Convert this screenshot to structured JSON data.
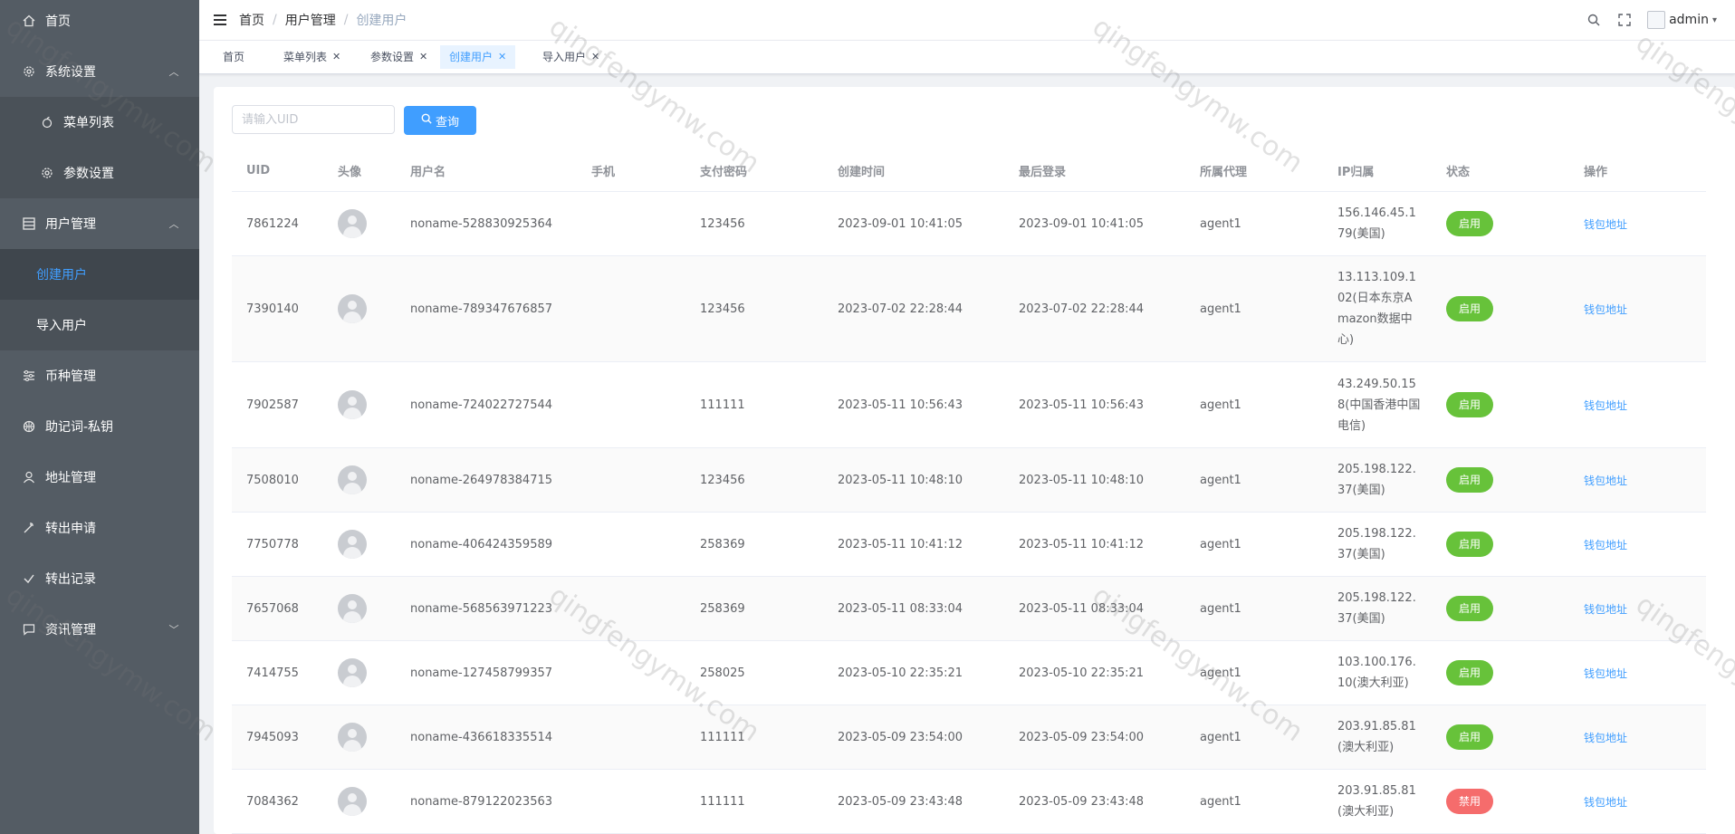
{
  "sidebar": {
    "items": [
      {
        "label": "首页",
        "icon": "home-icon"
      },
      {
        "label": "系统设置",
        "icon": "gear-icon"
      },
      {
        "label": "菜单列表",
        "icon": "apple-icon"
      },
      {
        "label": "参数设置",
        "icon": "gear-icon"
      },
      {
        "label": "用户管理",
        "icon": "grid-icon"
      },
      {
        "label": "创建用户"
      },
      {
        "label": "导入用户"
      },
      {
        "label": "币种管理",
        "icon": "sliders-icon"
      },
      {
        "label": "助记词-私钥",
        "icon": "basketball-icon"
      },
      {
        "label": "地址管理",
        "icon": "user-icon"
      },
      {
        "label": "转出申请",
        "icon": "magic-stick-icon"
      },
      {
        "label": "转出记录",
        "icon": "receipt-icon"
      },
      {
        "label": "资讯管理",
        "icon": "chat-icon"
      }
    ]
  },
  "header": {
    "breadcrumb": [
      "首页",
      "用户管理",
      "创建用户"
    ],
    "separator": "/",
    "user": "admin"
  },
  "tags": [
    {
      "label": "首页"
    },
    {
      "label": "菜单列表",
      "close": "✕"
    },
    {
      "label": "参数设置",
      "close": "✕"
    },
    {
      "label": "创建用户",
      "close": "✕"
    },
    {
      "label": "导入用户",
      "close": "✕"
    }
  ],
  "search": {
    "placeholder": "请输入UID",
    "button": "查询"
  },
  "table": {
    "columns": [
      "UID",
      "头像",
      "用户名",
      "手机",
      "支付密码",
      "创建时间",
      "最后登录",
      "所属代理",
      "IP归属",
      "状态",
      "操作"
    ],
    "rows": [
      {
        "uid": "7861224",
        "username": "noname-528830925364",
        "phone": "",
        "paypwd": "123456",
        "created": "2023-09-01 10:41:05",
        "lastlogin": "2023-09-01 10:41:05",
        "agent": "agent1",
        "ip": "156.146.45.179(美国)",
        "status": "启用",
        "action": "钱包地址"
      },
      {
        "uid": "7390140",
        "username": "noname-789347676857",
        "phone": "",
        "paypwd": "123456",
        "created": "2023-07-02 22:28:44",
        "lastlogin": "2023-07-02 22:28:44",
        "agent": "agent1",
        "ip": "13.113.109.102(日本东京Amazon数据中心)",
        "status": "启用",
        "action": "钱包地址"
      },
      {
        "uid": "7902587",
        "username": "noname-724022727544",
        "phone": "",
        "paypwd": "111111",
        "created": "2023-05-11 10:56:43",
        "lastlogin": "2023-05-11 10:56:43",
        "agent": "agent1",
        "ip": "43.249.50.158(中国香港中国电信)",
        "status": "启用",
        "action": "钱包地址"
      },
      {
        "uid": "7508010",
        "username": "noname-264978384715",
        "phone": "",
        "paypwd": "123456",
        "created": "2023-05-11 10:48:10",
        "lastlogin": "2023-05-11 10:48:10",
        "agent": "agent1",
        "ip": "205.198.122.37(美国)",
        "status": "启用",
        "action": "钱包地址"
      },
      {
        "uid": "7750778",
        "username": "noname-406424359589",
        "phone": "",
        "paypwd": "258369",
        "created": "2023-05-11 10:41:12",
        "lastlogin": "2023-05-11 10:41:12",
        "agent": "agent1",
        "ip": "205.198.122.37(美国)",
        "status": "启用",
        "action": "钱包地址"
      },
      {
        "uid": "7657068",
        "username": "noname-568563971223",
        "phone": "",
        "paypwd": "258369",
        "created": "2023-05-11 08:33:04",
        "lastlogin": "2023-05-11 08:33:04",
        "agent": "agent1",
        "ip": "205.198.122.37(美国)",
        "status": "启用",
        "action": "钱包地址"
      },
      {
        "uid": "7414755",
        "username": "noname-127458799357",
        "phone": "",
        "paypwd": "258025",
        "created": "2023-05-10 22:35:21",
        "lastlogin": "2023-05-10 22:35:21",
        "agent": "agent1",
        "ip": "103.100.176.10(澳大利亚)",
        "status": "启用",
        "action": "钱包地址"
      },
      {
        "uid": "7945093",
        "username": "noname-436618335514",
        "phone": "",
        "paypwd": "111111",
        "created": "2023-05-09 23:54:00",
        "lastlogin": "2023-05-09 23:54:00",
        "agent": "agent1",
        "ip": "203.91.85.81(澳大利亚)",
        "status": "启用",
        "action": "钱包地址"
      },
      {
        "uid": "7084362",
        "username": "noname-879122023563",
        "phone": "",
        "paypwd": "111111",
        "created": "2023-05-09 23:43:48",
        "lastlogin": "2023-05-09 23:43:48",
        "agent": "agent1",
        "ip": "203.91.85.81(澳大利亚)",
        "status": "禁用",
        "action": "钱包地址"
      }
    ]
  },
  "watermark": "qingfengymw.com",
  "colors": {
    "sidebar": "#545c64",
    "accent": "#409eff",
    "enabled": "#67c23a",
    "disabled": "#f56c6c"
  }
}
